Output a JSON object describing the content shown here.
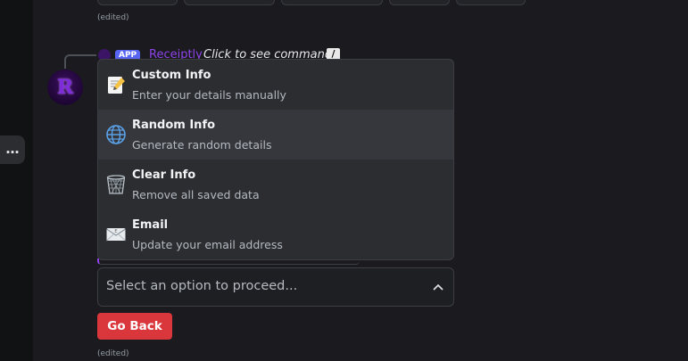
{
  "header": {
    "edited_top": "(edited)"
  },
  "reply": {
    "badge": "APP",
    "bot_name": "Receiptly",
    "command_text": "Click to see command",
    "command_icon": "slash-command-icon"
  },
  "avatar": {
    "letter": "R",
    "color": "#7e2bd9"
  },
  "more_button": {
    "label": "…"
  },
  "menu": {
    "options": [
      {
        "label": "Custom Info",
        "description": "Enter your details manually",
        "icon": "memo-icon"
      },
      {
        "label": "Random Info",
        "description": "Generate random details",
        "icon": "globe-icon"
      },
      {
        "label": "Clear Info",
        "description": "Remove all saved data",
        "icon": "wastebasket-icon"
      },
      {
        "label": "Email",
        "description": "Update your email address",
        "icon": "envelope-icon"
      }
    ]
  },
  "select": {
    "placeholder": "Select an option to proceed..."
  },
  "go_back": {
    "label": "Go Back",
    "color": "#da373c"
  },
  "footer": {
    "edited": "(edited)"
  },
  "colors": {
    "accent": "#5865f2",
    "bot_name": "#8e44e8"
  }
}
